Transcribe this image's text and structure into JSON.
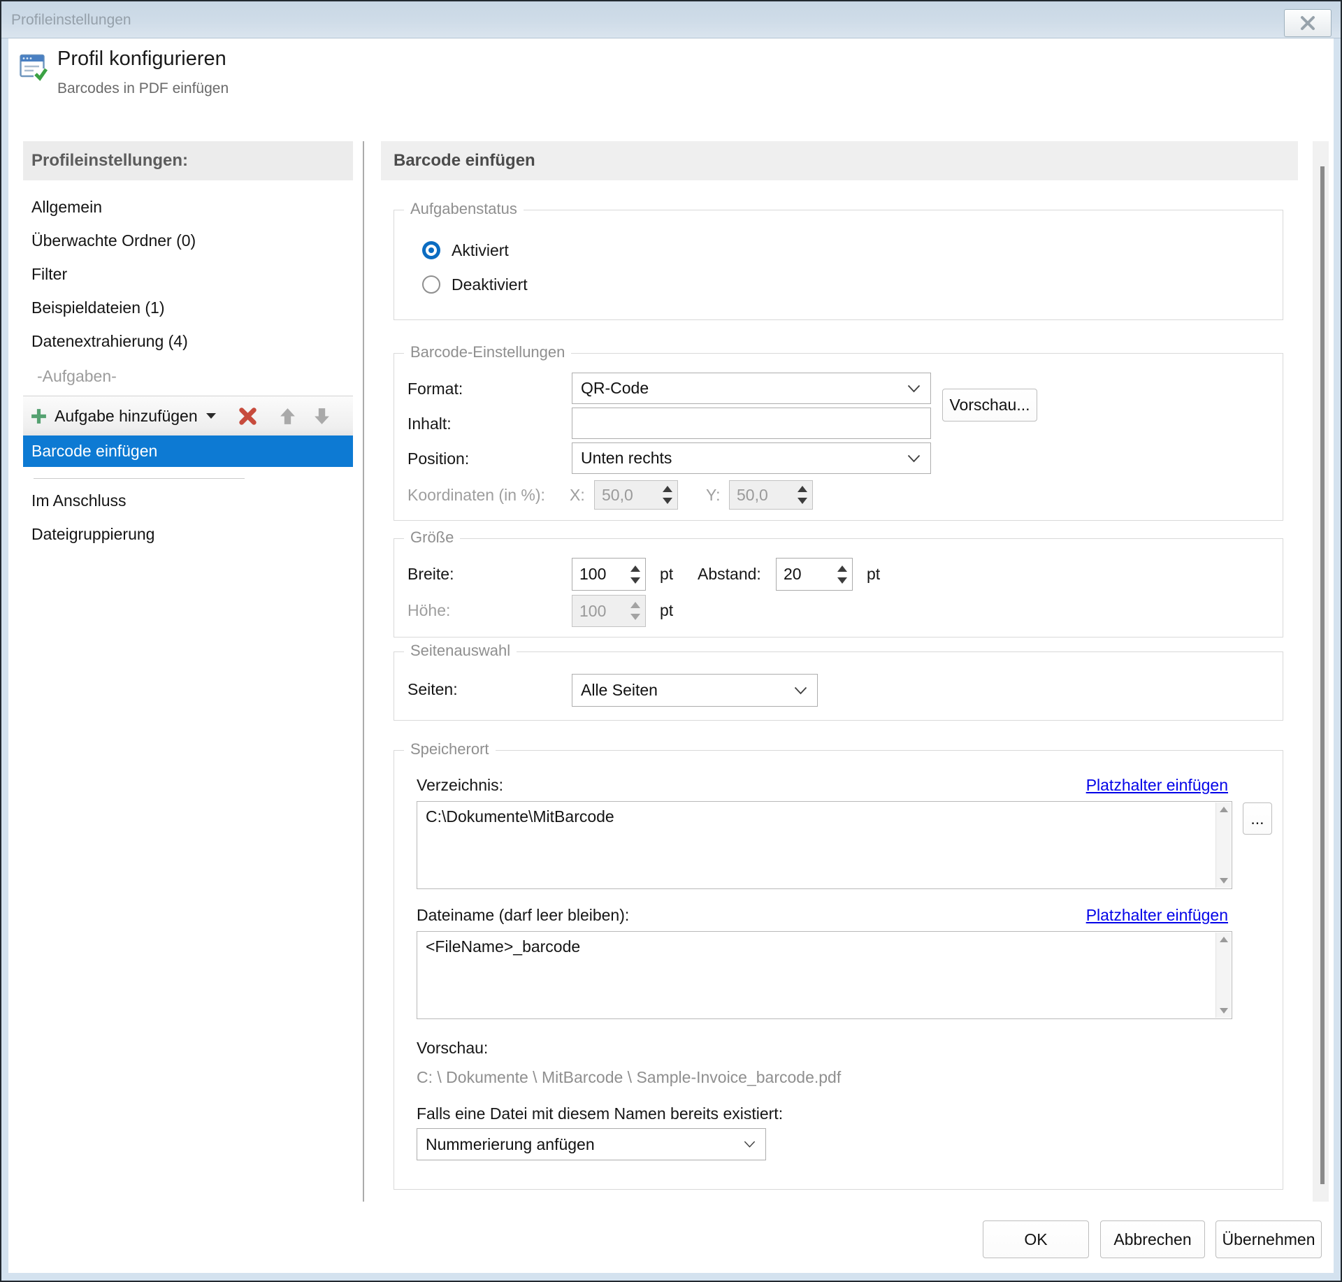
{
  "window": {
    "title": "Profileinstellungen"
  },
  "header": {
    "title": "Profil konfigurieren",
    "subtitle": "Barcodes in PDF einfügen"
  },
  "sidebar": {
    "header": "Profileinstellungen:",
    "items": [
      "Allgemein",
      "Überwachte Ordner (0)",
      "Filter",
      "Beispieldateien (1)",
      "Datenextrahierung (4)"
    ],
    "tasks_section_label": "-Aufgaben-",
    "add_task_label": "Aufgabe hinzufügen",
    "selected_task": "Barcode einfügen",
    "after_items": [
      "Im Anschluss",
      "Dateigruppierung"
    ]
  },
  "main": {
    "title": "Barcode einfügen",
    "status_group": {
      "legend": "Aufgabenstatus",
      "enabled_label": "Aktiviert",
      "disabled_label": "Deaktiviert"
    },
    "barcode_group": {
      "legend": "Barcode-Einstellungen",
      "format_label": "Format:",
      "format_value": "QR-Code",
      "preview_button": "Vorschau...",
      "content_label": "Inhalt:",
      "content_value": "",
      "position_label": "Position:",
      "position_value": "Unten rechts",
      "coords_label": "Koordinaten (in %):",
      "x_label": "X:",
      "x_value": "50,0",
      "y_label": "Y:",
      "y_value": "50,0"
    },
    "size_group": {
      "legend": "Größe",
      "width_label": "Breite:",
      "width_value": "100",
      "width_unit": "pt",
      "spacing_label": "Abstand:",
      "spacing_value": "20",
      "spacing_unit": "pt",
      "height_label": "Höhe:",
      "height_value": "100",
      "height_unit": "pt"
    },
    "pages_group": {
      "legend": "Seitenauswahl",
      "pages_label": "Seiten:",
      "pages_value": "Alle Seiten"
    },
    "location_group": {
      "legend": "Speicherort",
      "directory_label": "Verzeichnis:",
      "directory_placeholder_link": "Platzhalter einfügen",
      "directory_value": "C:\\Dokumente\\MitBarcode",
      "browse_button": "...",
      "filename_label": "Dateiname (darf leer bleiben):",
      "filename_placeholder_link": "Platzhalter einfügen",
      "filename_value": "<FileName>_barcode",
      "preview_label": "Vorschau:",
      "preview_value": "C: \\ Dokumente \\ MitBarcode \\ Sample-Invoice_barcode.pdf",
      "exists_label": "Falls eine Datei mit diesem Namen bereits existiert:",
      "exists_value": "Nummerierung anfügen"
    }
  },
  "footer": {
    "ok": "OK",
    "cancel": "Abbrechen",
    "apply": "Übernehmen"
  },
  "colors": {
    "selection": "#0d7ad3",
    "link": "#0404e8",
    "add_green": "#55a171",
    "delete_red": "#c74b3c",
    "radio_blue": "#0b6cc1"
  }
}
